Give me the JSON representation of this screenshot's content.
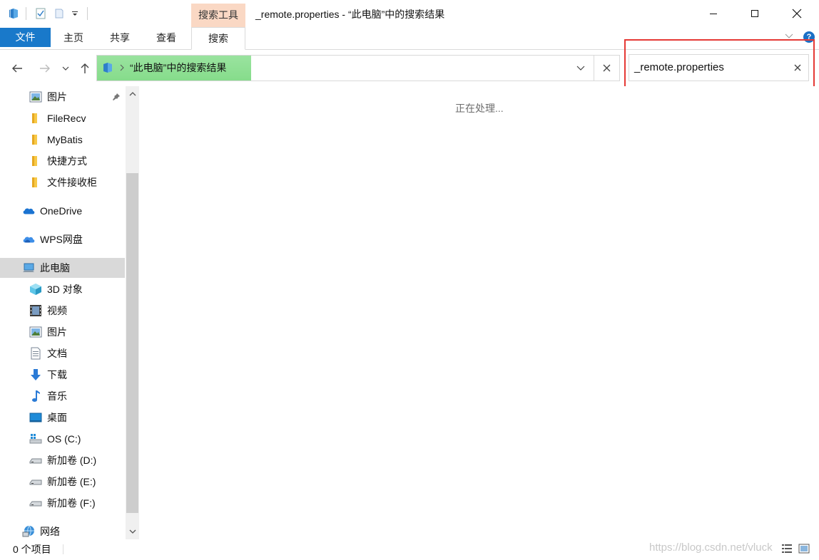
{
  "window": {
    "title": "_remote.properties - “此电脑”中的搜索结果",
    "context_tab": "搜索工具"
  },
  "ribbon": {
    "tabs": [
      {
        "label": "文件"
      },
      {
        "label": "主页"
      },
      {
        "label": "共享"
      },
      {
        "label": "查看"
      },
      {
        "label": "搜索"
      }
    ],
    "help_glyph": "?"
  },
  "address": {
    "path_text": "“此电脑”中的搜索结果"
  },
  "search": {
    "value": "_remote.properties"
  },
  "sidebar": {
    "items": [
      {
        "label": "图片",
        "icon": "pictures-icon"
      },
      {
        "label": "FileRecv",
        "icon": "folder-icon"
      },
      {
        "label": "MyBatis",
        "icon": "folder-icon"
      },
      {
        "label": "快捷方式",
        "icon": "folder-icon"
      },
      {
        "label": "文件接收柜",
        "icon": "folder-icon"
      },
      {
        "label": "OneDrive",
        "icon": "onedrive-icon"
      },
      {
        "label": "WPS网盘",
        "icon": "wps-cloud-icon"
      },
      {
        "label": "此电脑",
        "icon": "computer-icon"
      },
      {
        "label": "3D 对象",
        "icon": "3d-objects-icon"
      },
      {
        "label": "视频",
        "icon": "videos-icon"
      },
      {
        "label": "图片",
        "icon": "pictures-icon"
      },
      {
        "label": "文档",
        "icon": "documents-icon"
      },
      {
        "label": "下载",
        "icon": "downloads-icon"
      },
      {
        "label": "音乐",
        "icon": "music-icon"
      },
      {
        "label": "桌面",
        "icon": "desktop-icon"
      },
      {
        "label": "OS (C:)",
        "icon": "windows-drive-icon"
      },
      {
        "label": "新加卷 (D:)",
        "icon": "drive-icon"
      },
      {
        "label": "新加卷 (E:)",
        "icon": "drive-icon"
      },
      {
        "label": "新加卷 (F:)",
        "icon": "drive-icon"
      },
      {
        "label": "网络",
        "icon": "network-icon"
      }
    ]
  },
  "main": {
    "status_message": "正在处理..."
  },
  "statusbar": {
    "item_count": "0 个项目",
    "watermark": "https://blog.csdn.net/vluck"
  },
  "colors": {
    "file_tab": "#1979ca",
    "context_tab": "#fad8c4",
    "progress": "#86dc8b",
    "highlight": "#e53935",
    "selected": "#d9d9d9"
  }
}
